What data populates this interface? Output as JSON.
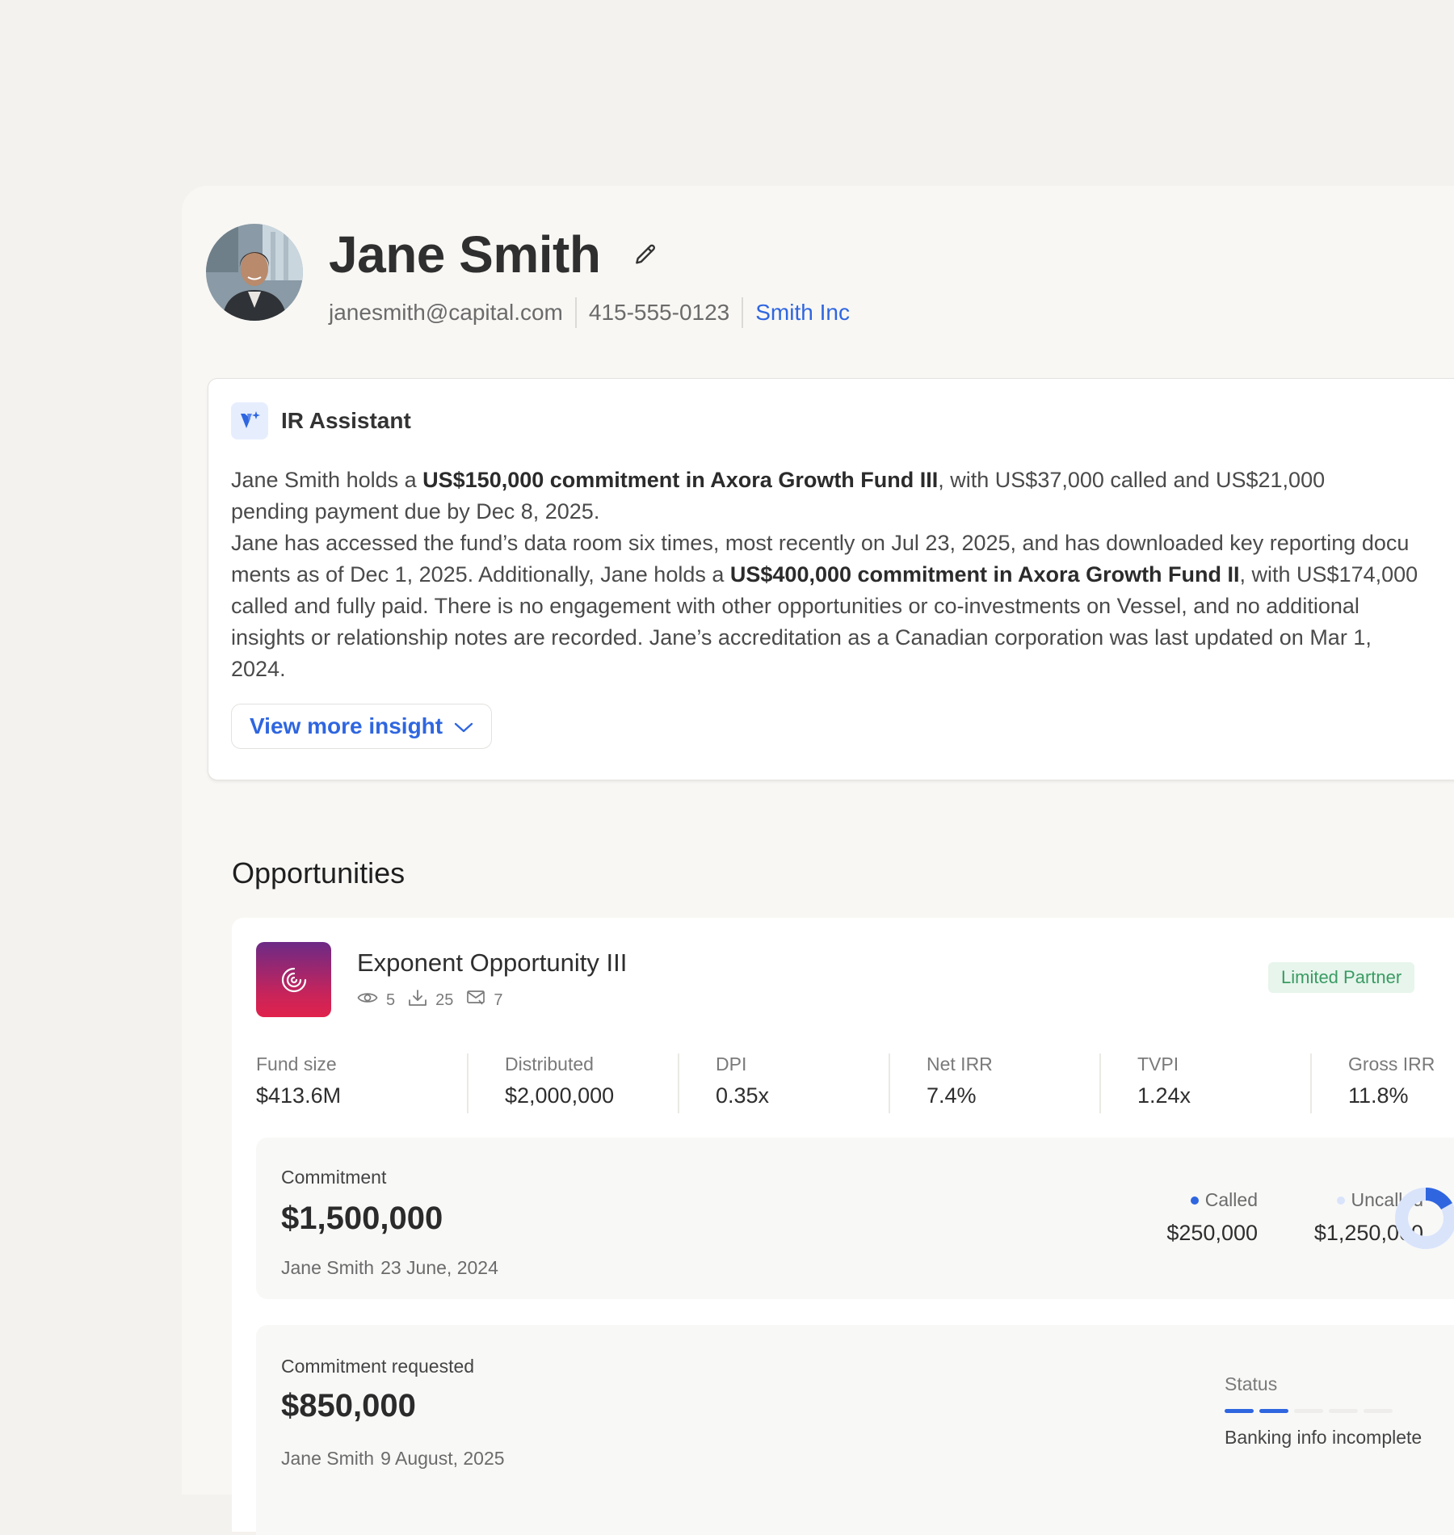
{
  "profile": {
    "name": "Jane Smith",
    "email": "janesmith@capital.com",
    "phone": "415-555-0123",
    "company": "Smith Inc"
  },
  "assistant": {
    "title": "IR Assistant",
    "p1": {
      "a": "Jane Smith holds a ",
      "b": "US$150,000 commitment in Axora Growth Fund III",
      "c": ",  with US$37,000 called and US$21,000"
    },
    "p2": "pending payment due by Dec 8, 2025.",
    "p3": "Jane has accessed the fund’s data room six times, most recently on Jul 23, 2025, and has downloaded key reporting docu",
    "p4": {
      "a": "ments as of Dec 1, 2025.  Additionally, Jane holds a ",
      "b": "US$400,000 commitment in Axora Growth Fund II",
      "c": ", with US$174,000"
    },
    "p5": "called and fully paid. There is no engagement with other opportunities or co-investments on Vessel, and no additional",
    "p6": " insights or relationship notes are recorded. Jane’s accreditation as a Canadian corporation was last updated on Mar 1,",
    "p7": "2024.",
    "view_more": "View more insight"
  },
  "opportunities": {
    "title": "Opportunities",
    "fund": {
      "name": "Exponent Opportunity III",
      "views": "5",
      "downloads": "25",
      "messages": "7",
      "role": "Limited Partner"
    },
    "metrics": [
      {
        "label": "Fund size",
        "value": "$413.6M"
      },
      {
        "label": "Distributed",
        "value": "$2,000,000"
      },
      {
        "label": "DPI",
        "value": "0.35x"
      },
      {
        "label": "Net IRR",
        "value": "7.4%"
      },
      {
        "label": "TVPI",
        "value": "1.24x"
      },
      {
        "label": "Gross IRR",
        "value": "11.8%"
      }
    ],
    "commitment": {
      "label": "Commitment",
      "amount": "$1,500,000",
      "by": "Jane Smith",
      "date": "23 June, 2024",
      "called_label": "Called",
      "called_value": "$250,000",
      "uncalled_label": "Uncalled",
      "uncalled_value": "$1,250,000",
      "called_fraction": 0.1667
    },
    "request": {
      "label": "Commitment requested",
      "amount": "$850,000",
      "by": "Jane Smith",
      "date": "9 August, 2025",
      "status_label": "Status",
      "status_text": "Banking info incomplete",
      "steps_done": 2,
      "steps_total": 5
    }
  },
  "colors": {
    "accent": "#2f66e0",
    "uncalled": "#d9e4fb",
    "lp_badge_bg": "#e7f5ec",
    "lp_badge_text": "#3a9b63"
  }
}
